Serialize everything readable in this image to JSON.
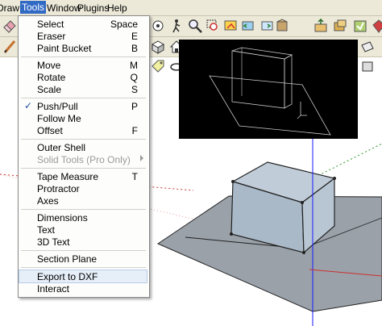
{
  "menubar": {
    "items": [
      "Draw",
      "Tools",
      "Window",
      "Plugins",
      "Help"
    ]
  },
  "tools_menu": {
    "items": [
      {
        "label": "Select",
        "shortcut": "Space"
      },
      {
        "label": "Eraser",
        "shortcut": "E"
      },
      {
        "label": "Paint Bucket",
        "shortcut": "B"
      },
      {
        "label": "Move",
        "shortcut": "M"
      },
      {
        "label": "Rotate",
        "shortcut": "Q"
      },
      {
        "label": "Scale",
        "shortcut": "S"
      },
      {
        "label": "Push/Pull",
        "shortcut": "P",
        "checked": true
      },
      {
        "label": "Follow Me",
        "shortcut": ""
      },
      {
        "label": "Offset",
        "shortcut": "F"
      },
      {
        "label": "Outer Shell",
        "shortcut": ""
      },
      {
        "label": "Solid Tools (Pro Only)",
        "shortcut": "",
        "disabled": true,
        "submenu": true
      },
      {
        "label": "Tape Measure",
        "shortcut": "T"
      },
      {
        "label": "Protractor",
        "shortcut": ""
      },
      {
        "label": "Axes",
        "shortcut": ""
      },
      {
        "label": "Dimensions",
        "shortcut": ""
      },
      {
        "label": "Text",
        "shortcut": ""
      },
      {
        "label": "3D Text",
        "shortcut": ""
      },
      {
        "label": "Section Plane",
        "shortcut": ""
      },
      {
        "label": "Export to DXF",
        "shortcut": "",
        "highlighted": true
      },
      {
        "label": "Interact",
        "shortcut": ""
      }
    ]
  },
  "colors": {
    "chrome": "#ece9d8",
    "menu_highlight": "#316ac5",
    "box_front": "#a9b9c8",
    "box_top": "#c0ccd8",
    "box_side": "#b8c6d3",
    "ground": "#9aa1a9",
    "axis_blue": "#1a1aff",
    "axis_red": "#cc3030",
    "axis_green": "#2a9a2a"
  }
}
